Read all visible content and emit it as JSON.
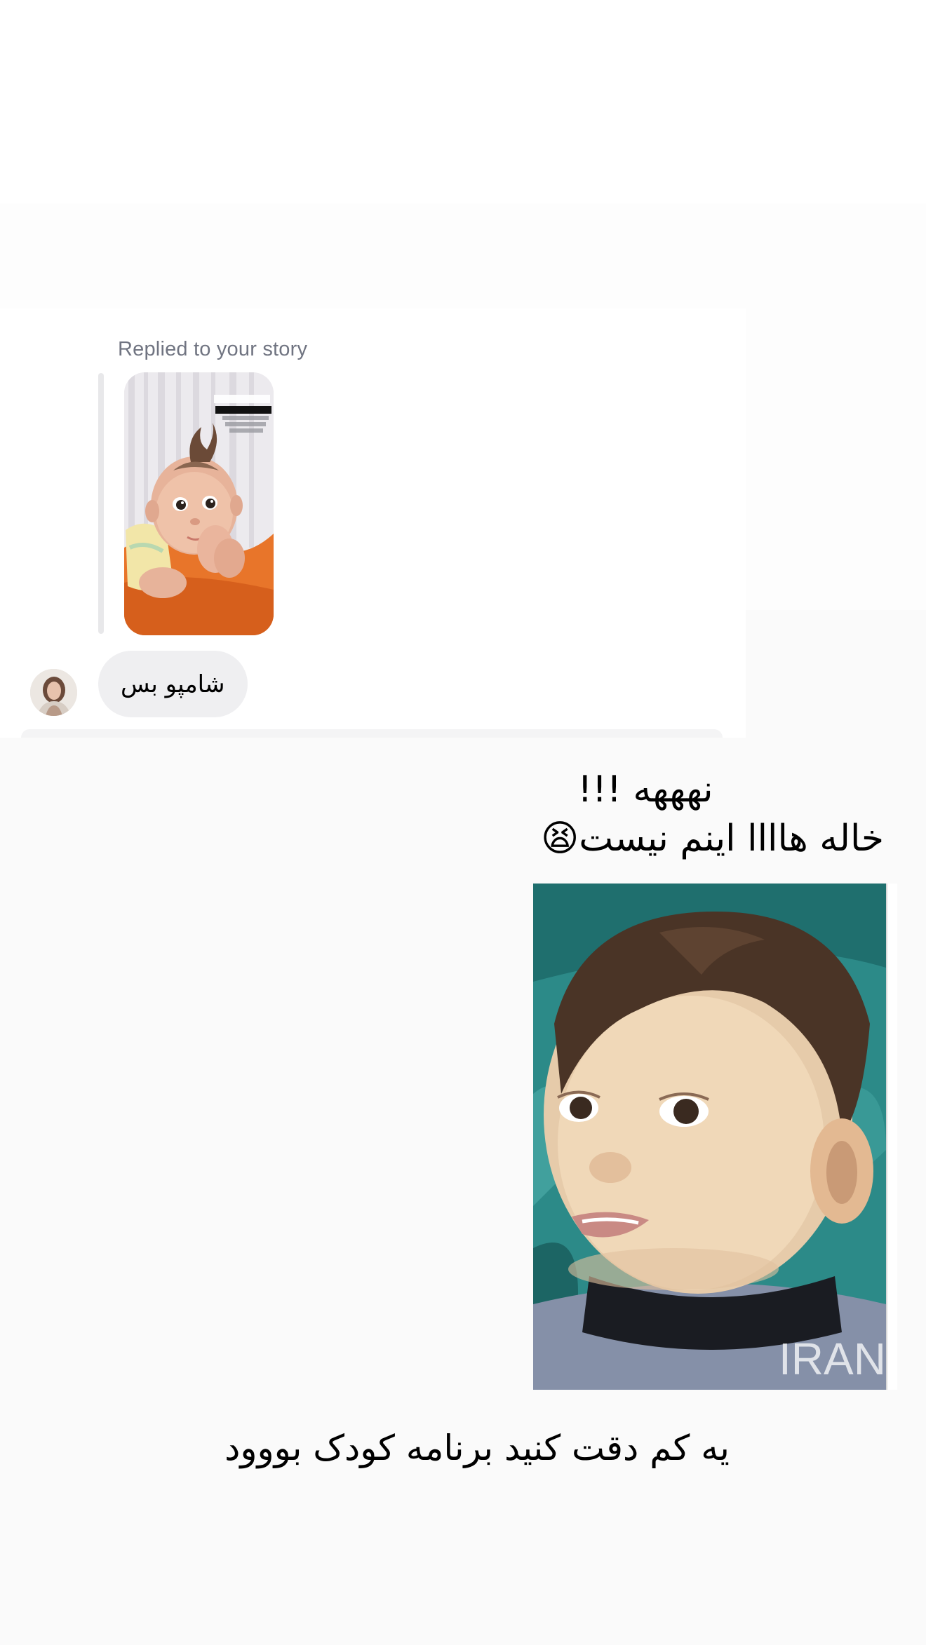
{
  "story_reply": {
    "label": "Replied to your story",
    "thumbnail_icon": "story-thumbnail-baby-photo",
    "thumbnail_text": {
      "line1": "خاله ها سلام 🖐",
      "line2": "که گفتید من شبیه کی شدم؟ 👀",
      "line3": "با شباهت زیاد به عکس هاتون",
      "line4": "پاداش ها داده میشن"
    }
  },
  "incoming_message": {
    "avatar_icon": "user-avatar",
    "text": "شامپو بس"
  },
  "post": {
    "caption_line1": "نهههه !!!",
    "caption_line2": "خاله هاااا اینم نیست😫",
    "image_icon": "child-photo",
    "watermark": "IRAN",
    "footer": "یه کم دقت کنید برنامه کودک بووود"
  },
  "colors": {
    "page_bg": "#fafafa",
    "bubble_bg": "#efeff1",
    "label_gray": "#707481",
    "reply_bar": "#e8e8ea"
  }
}
